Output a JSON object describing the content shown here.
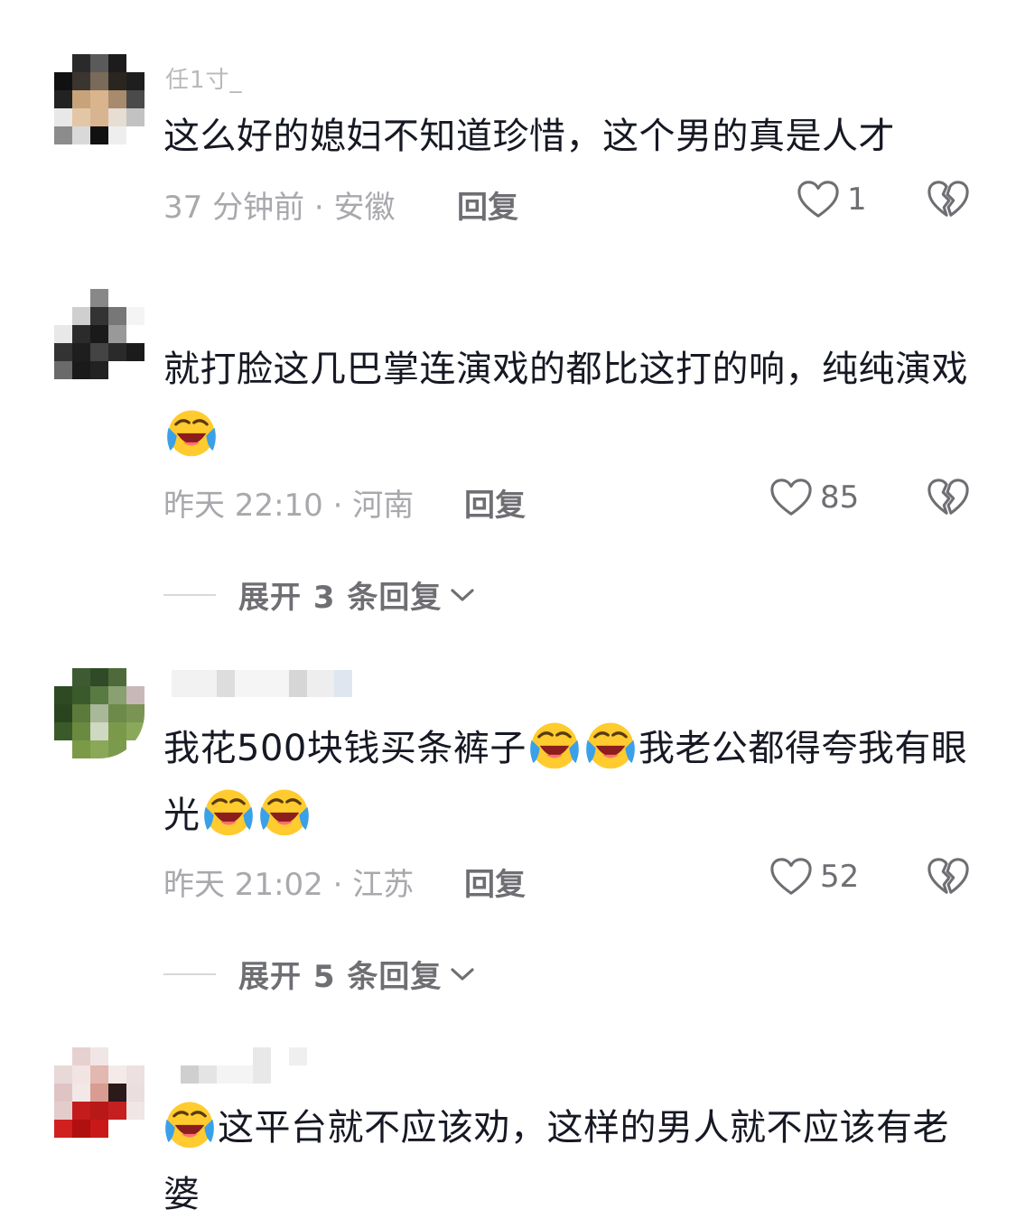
{
  "comments": [
    {
      "username": "任1寸_",
      "text": "这么好的媳妇不知道珍惜，这个男的真是人才",
      "meta": "37 分钟前 · 安徽",
      "reply_label": "回复",
      "likes": "1"
    },
    {
      "username": "",
      "text": "就打脸这几巴掌连演戏的都比这打的响，纯纯演戏",
      "meta": "昨天 22:10 · 河南",
      "reply_label": "回复",
      "likes": "85",
      "expand_label": "展开 3 条回复"
    },
    {
      "username": "",
      "text_a": "我花500块钱买条裤子",
      "text_b": "我老公都得夸我有眼光",
      "meta": "昨天 21:02 · 江苏",
      "reply_label": "回复",
      "likes": "52",
      "expand_label": "展开 5 条回复"
    },
    {
      "username": "",
      "text": "这平台就不应该劝，这样的男人就不应该有老婆"
    }
  ],
  "icons": {
    "emoji": "laugh-cry-emoji-icon",
    "like": "heart-icon",
    "dislike": "broken-heart-icon",
    "expand": "chevron-down-icon"
  },
  "colors": {
    "text": "#161823",
    "meta": "#a8a8ad",
    "action": "#6e6e73"
  }
}
